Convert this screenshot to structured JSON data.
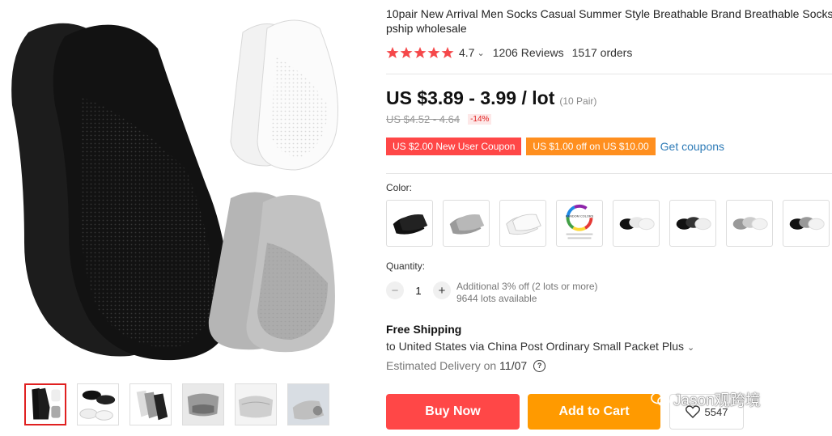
{
  "product": {
    "title": "10pair New Arrival Men Socks Casual Summer Style Breathable Brand Breathable Socks Dro",
    "title_line2": "pship wholesale"
  },
  "rating": {
    "value": "4.7",
    "stars": 5,
    "reviews": "1206 Reviews",
    "orders": "1517 orders"
  },
  "price": {
    "current": "US $3.89 - 3.99 / lot",
    "unit_note": "(10 Pair)",
    "original": "US $4.52 - 4.64",
    "discount": "-14%"
  },
  "coupons": {
    "new_user": "US $2.00 New User Coupon",
    "store": "US $1.00 off on US $10.00",
    "get_label": "Get coupons"
  },
  "color": {
    "label": "Color:",
    "options": [
      {
        "name": "black-socks-option"
      },
      {
        "name": "gray-socks-option"
      },
      {
        "name": "white-socks-option"
      },
      {
        "name": "random-color-option",
        "text": "RANDOM COLORS"
      },
      {
        "name": "black-white-mix-option"
      },
      {
        "name": "black-mix-option"
      },
      {
        "name": "gray-white-mix-option"
      },
      {
        "name": "black-gray-white-mix-option"
      }
    ]
  },
  "quantity": {
    "label": "Quantity:",
    "value": "1",
    "minus": "−",
    "plus": "+",
    "note1": "Additional 3% off (2 lots or more)",
    "note2": "9644 lots available"
  },
  "shipping": {
    "title": "Free Shipping",
    "to": "to United States via China Post Ordinary Small Packet Plus",
    "est_prefix": "Estimated Delivery on",
    "est_date": "11/07",
    "help": "?"
  },
  "actions": {
    "buy_now": "Buy Now",
    "add_to_cart": "Add to Cart",
    "wishlist_count": "5547"
  },
  "watermark": "Jason观跨境",
  "colors": {
    "accent_red": "#ff4747",
    "accent_orange": "#ff9a00",
    "link_blue": "#2e7bb7",
    "star_red": "#f5484a"
  }
}
